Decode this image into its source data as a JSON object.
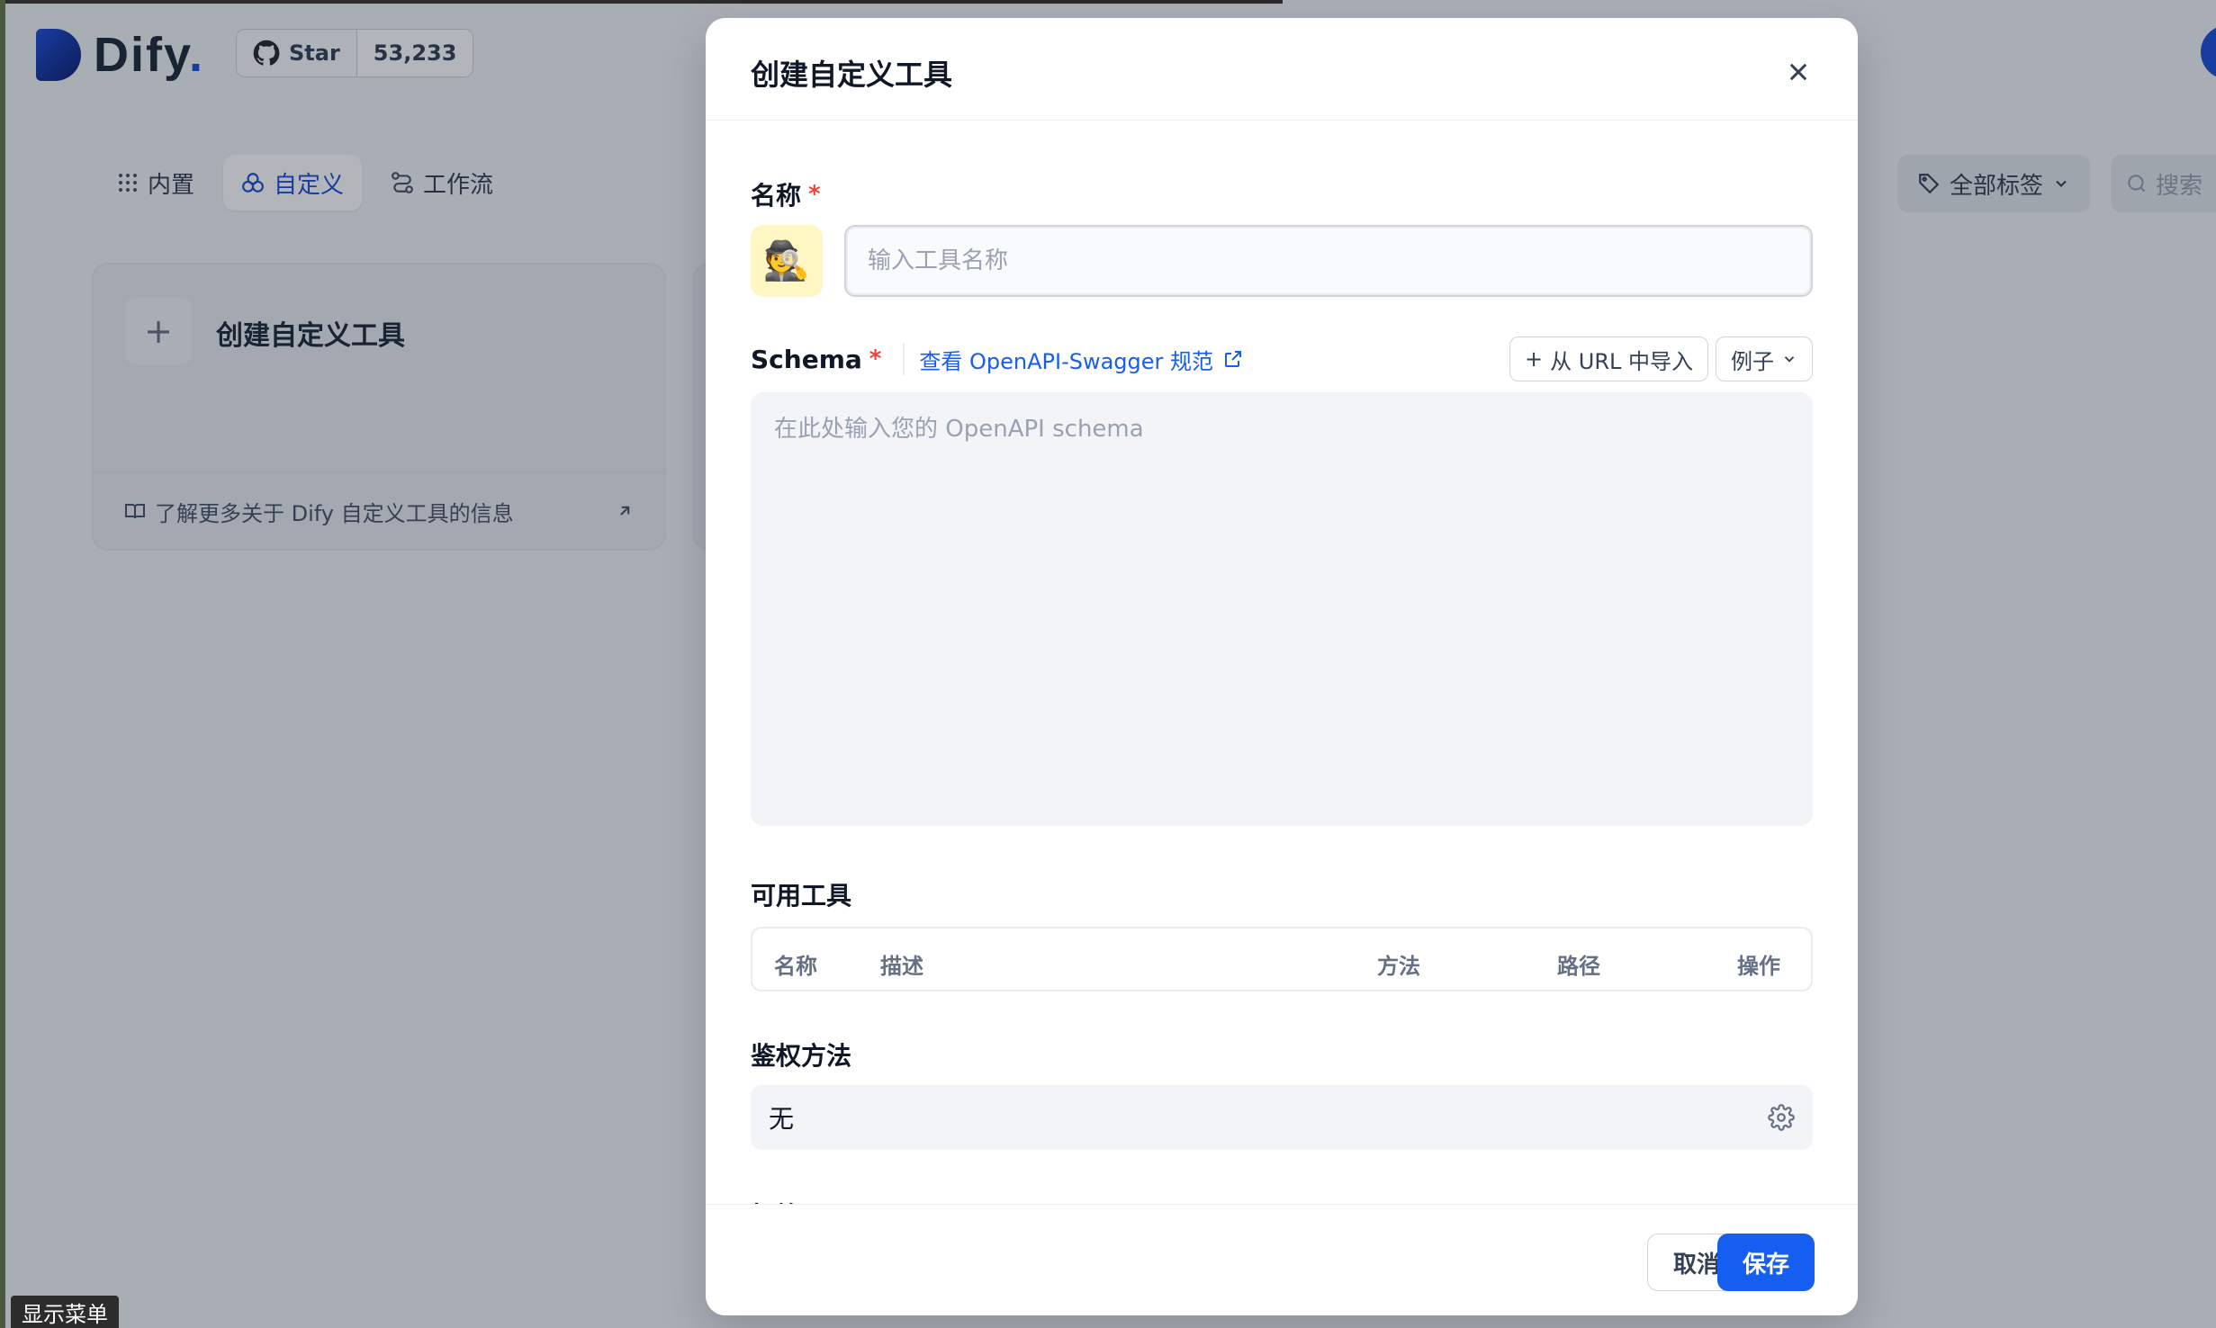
{
  "brand": {
    "name": "Dify",
    "dot": "."
  },
  "github": {
    "star_label": "Star",
    "count": "53,233"
  },
  "tabs": [
    {
      "label": "内置",
      "icon": "grid-icon"
    },
    {
      "label": "自定义",
      "icon": "custom-icon"
    },
    {
      "label": "工作流",
      "icon": "workflow-icon"
    }
  ],
  "toolbar": {
    "tags_label": "全部标签",
    "search_placeholder": "搜索"
  },
  "card": {
    "title": "创建自定义工具",
    "footer": "了解更多关于 Dify 自定义工具的信息"
  },
  "menu_hint": "显示菜单",
  "modal": {
    "title": "创建自定义工具",
    "name_label": "名称",
    "required_mark": "*",
    "name_placeholder": "输入工具名称",
    "emoji": "🕵️",
    "schema_label": "Schema",
    "schema_link": "查看 OpenAPI-Swagger 规范",
    "import_url": "从 URL 中导入",
    "examples": "例子",
    "schema_placeholder": "在此处输入您的 OpenAPI schema",
    "tools_label": "可用工具",
    "table_headers": [
      "名称",
      "描述",
      "方法",
      "路径",
      "操作"
    ],
    "auth_label": "鉴权方法",
    "auth_value": "无",
    "tags_label": "标签",
    "cancel": "取消",
    "save": "保存"
  },
  "colors": {
    "accent": "#155eef",
    "required": "#f04438"
  }
}
